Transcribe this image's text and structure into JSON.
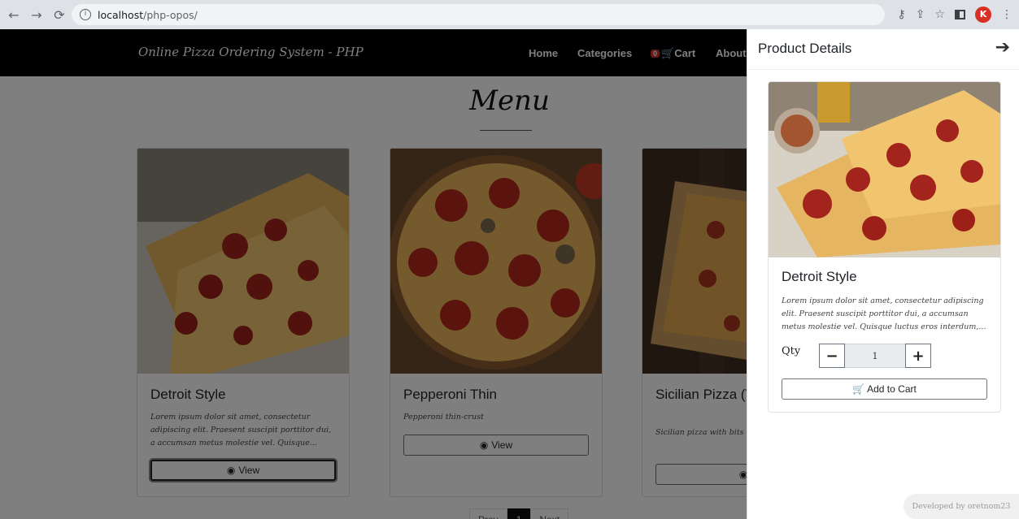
{
  "browser": {
    "url_host": "localhost",
    "url_path": "/php-opos/",
    "profile_initial": "K"
  },
  "site": {
    "brand": "Online Pizza Ordering System - PHP",
    "nav": {
      "home": "Home",
      "categories": "Categories",
      "cart_count": "0",
      "cart": "Cart",
      "about": "About"
    },
    "menu_heading": "Menu"
  },
  "products": [
    {
      "title": "Detroit Style",
      "desc": "Lorem ipsum dolor sit amet, consectetur adipiscing elit. Praesent suscipit porttitor dui, a accumsan metus molestie vel. Quisque...",
      "view_label": "View"
    },
    {
      "title": "Pepperoni Thin",
      "desc": "Pepperoni thin-crust",
      "view_label": "View"
    },
    {
      "title": "Sicilian Pizza (T Toppings)",
      "desc": "Sicilian pizza with bits anchovies, and herbs t",
      "view_label": "V"
    }
  ],
  "pagination": {
    "prev": "Prev",
    "current": "1",
    "next": "Next"
  },
  "panel": {
    "title": "Product Details",
    "product_title": "Detroit Style",
    "product_desc": "Lorem ipsum dolor sit amet, consectetur adipiscing elit. Praesent suscipit porttitor dui, a accumsan metus molestie vel. Quisque luctus eros interdum,...",
    "qty_label": "Qty",
    "qty_value": "1",
    "add_to_cart": "Add to Cart"
  },
  "footer": {
    "credit": "Developed by oretnom23"
  },
  "icons": {
    "back": "arrow-left-icon",
    "forward": "arrow-right-icon",
    "reload": "reload-icon",
    "info": "info-icon",
    "key": "key-icon",
    "share": "share-icon",
    "bookmark": "star-icon",
    "sidepanel": "side-panel-icon",
    "menu": "kebab-menu-icon",
    "cart": "cart-icon",
    "eye": "eye-icon",
    "close_panel": "arrow-right-icon"
  },
  "colors": {
    "navbar": "#000000",
    "badge": "#c9302c",
    "profile": "#d93025"
  }
}
